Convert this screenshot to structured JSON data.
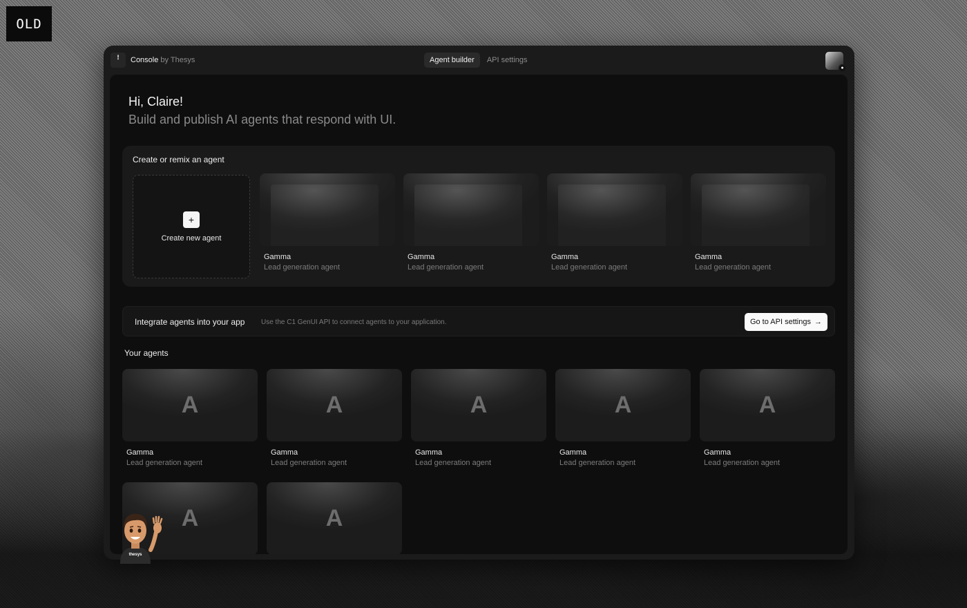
{
  "badge": "OLD",
  "header": {
    "brand_name": "Console",
    "brand_by": "by Thesys",
    "tabs": [
      "Agent builder",
      "API settings"
    ]
  },
  "greeting": {
    "title": "Hi, Claire!",
    "subtitle": "Build and publish AI agents that respond with UI."
  },
  "create": {
    "title": "Create or remix an agent",
    "new_label": "Create new agent",
    "plus": "+",
    "templates": [
      {
        "name": "Gamma",
        "desc": "Lead generation agent"
      },
      {
        "name": "Gamma",
        "desc": "Lead generation agent"
      },
      {
        "name": "Gamma",
        "desc": "Lead generation agent"
      },
      {
        "name": "Gamma",
        "desc": "Lead generation agent"
      }
    ]
  },
  "integrate": {
    "title": "Integrate agents into your app",
    "subtitle": "Use the C1 GenUI API to connect agents to your application.",
    "button": "Go to API settings",
    "arrow": "→"
  },
  "agents": {
    "title": "Your agents",
    "items": [
      {
        "letter": "A",
        "name": "Gamma",
        "desc": "Lead generation agent"
      },
      {
        "letter": "A",
        "name": "Gamma",
        "desc": "Lead generation agent"
      },
      {
        "letter": "A",
        "name": "Gamma",
        "desc": "Lead generation agent"
      },
      {
        "letter": "A",
        "name": "Gamma",
        "desc": "Lead generation agent"
      },
      {
        "letter": "A",
        "name": "Gamma",
        "desc": "Lead generation agent"
      },
      {
        "letter": "A"
      },
      {
        "letter": "A"
      }
    ]
  },
  "memoji": {
    "shirt_text": "thesys"
  }
}
